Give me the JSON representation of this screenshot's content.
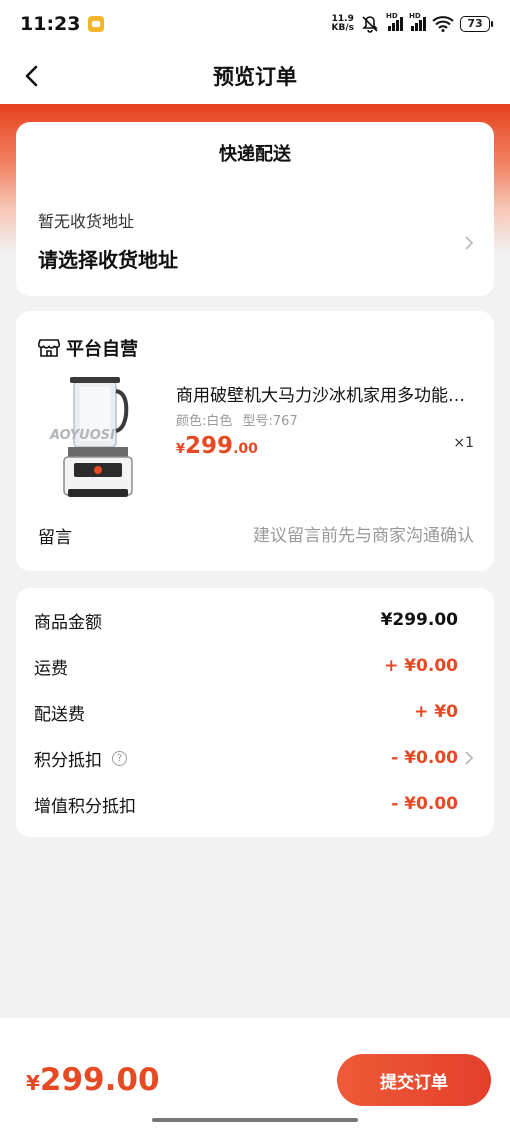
{
  "status_bar": {
    "time": "11:23",
    "speed_value": "11.9",
    "speed_unit": "KB/s",
    "hd1": "HD",
    "hd2": "HD",
    "battery": "73"
  },
  "nav": {
    "title": "预览订单"
  },
  "delivery": {
    "title": "快递配送",
    "address_hint": "暂无收货地址",
    "address_select": "请选择收货地址"
  },
  "product_card": {
    "shop_name": "平台自营",
    "product": {
      "title": "商用破壁机大马力沙冰机家用多功能料理机",
      "spec_color": "颜色:白色",
      "spec_model": "型号:767",
      "price_currency": "¥",
      "price_int": "299",
      "price_dec": ".00",
      "quantity": "×1",
      "image_brand_text": "AOYUOSI"
    },
    "remark_label": "留言",
    "remark_placeholder": "建议留言前先与商家沟通确认"
  },
  "summary": {
    "rows": [
      {
        "label": "商品金额",
        "value": "¥299.00",
        "color": "#111111"
      },
      {
        "label": "运费",
        "value": "+ ¥0.00",
        "color": "#e64a24"
      },
      {
        "label": "配送费",
        "value": "+ ¥0",
        "color": "#e64a24"
      },
      {
        "label": "积分抵扣",
        "value": "- ¥0.00",
        "color": "#e64a24",
        "help_icon": "?"
      },
      {
        "label": "增值积分抵扣",
        "value": "- ¥0.00",
        "color": "#e64a24"
      }
    ]
  },
  "bottom": {
    "total_currency": "¥",
    "total_amount": "299.00",
    "submit_label": "提交订单"
  },
  "colors": {
    "accent": "#e64a24",
    "header_red": "#e8401f",
    "background": "#f2f2f2"
  }
}
